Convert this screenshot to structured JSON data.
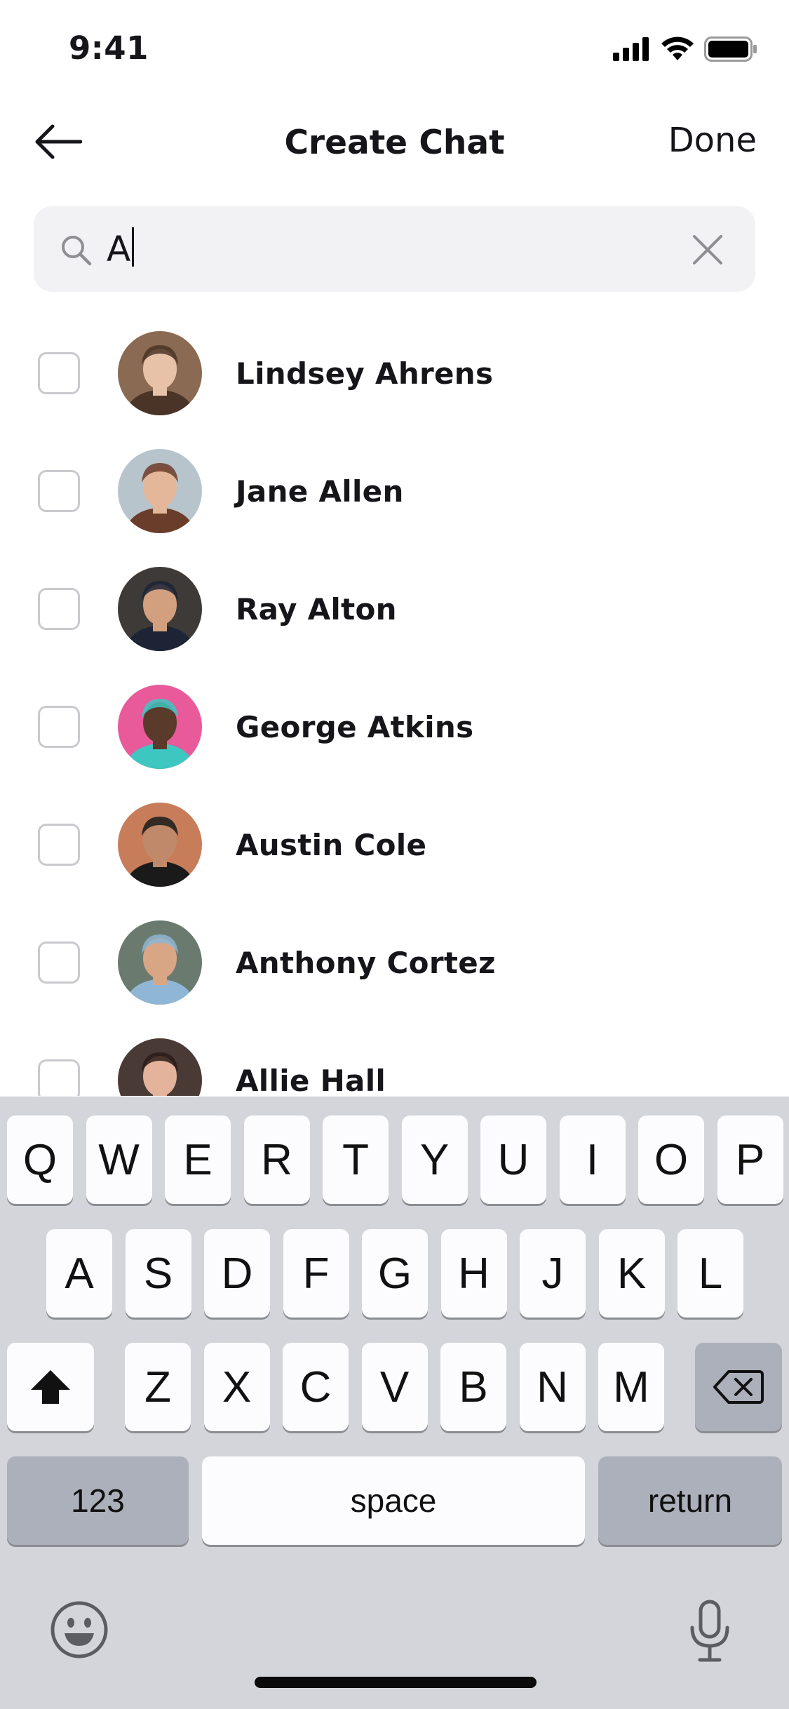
{
  "status_bar": {
    "time": "9:41",
    "icons": [
      "signal-icon",
      "wifi-icon",
      "battery-icon"
    ]
  },
  "nav": {
    "back_icon": "arrow-left-icon",
    "title": "Create Chat",
    "done_label": "Done"
  },
  "search": {
    "icon": "search-icon",
    "value": "A",
    "clear_icon": "close-icon"
  },
  "contacts": [
    {
      "name": "Lindsey Ahrens",
      "checked": false,
      "avatar_colors": [
        "#8a6a52",
        "#e8c2a8",
        "#4a3427"
      ]
    },
    {
      "name": "Jane Allen",
      "checked": false,
      "avatar_colors": [
        "#b8c4cc",
        "#e4b79a",
        "#6a3d2a"
      ]
    },
    {
      "name": "Ray Alton",
      "checked": false,
      "avatar_colors": [
        "#3d3a38",
        "#d2a07e",
        "#1d2436"
      ]
    },
    {
      "name": "George Atkins",
      "checked": false,
      "avatar_colors": [
        "#e85a9a",
        "#5a3a2a",
        "#3ec6c0"
      ]
    },
    {
      "name": "Austin Cole",
      "checked": false,
      "avatar_colors": [
        "#c77d5a",
        "#c08a6a",
        "#1a1a1a"
      ]
    },
    {
      "name": "Anthony Cortez",
      "checked": false,
      "avatar_colors": [
        "#6b7a6e",
        "#d9a685",
        "#8fb6d4"
      ]
    },
    {
      "name": "Allie Hall",
      "checked": false,
      "avatar_colors": [
        "#4a3a36",
        "#e4b39c",
        "#2a1c18"
      ]
    }
  ],
  "keyboard": {
    "row1": [
      "Q",
      "W",
      "E",
      "R",
      "T",
      "Y",
      "U",
      "I",
      "O",
      "P"
    ],
    "row2": [
      "A",
      "S",
      "D",
      "F",
      "G",
      "H",
      "J",
      "K",
      "L"
    ],
    "row3": [
      "Z",
      "X",
      "C",
      "V",
      "B",
      "N",
      "M"
    ],
    "shift_icon": "shift-icon",
    "delete_icon": "backspace-icon",
    "numbers_label": "123",
    "space_label": "space",
    "return_label": "return",
    "emoji_icon": "emoji-icon",
    "mic_icon": "microphone-icon"
  }
}
